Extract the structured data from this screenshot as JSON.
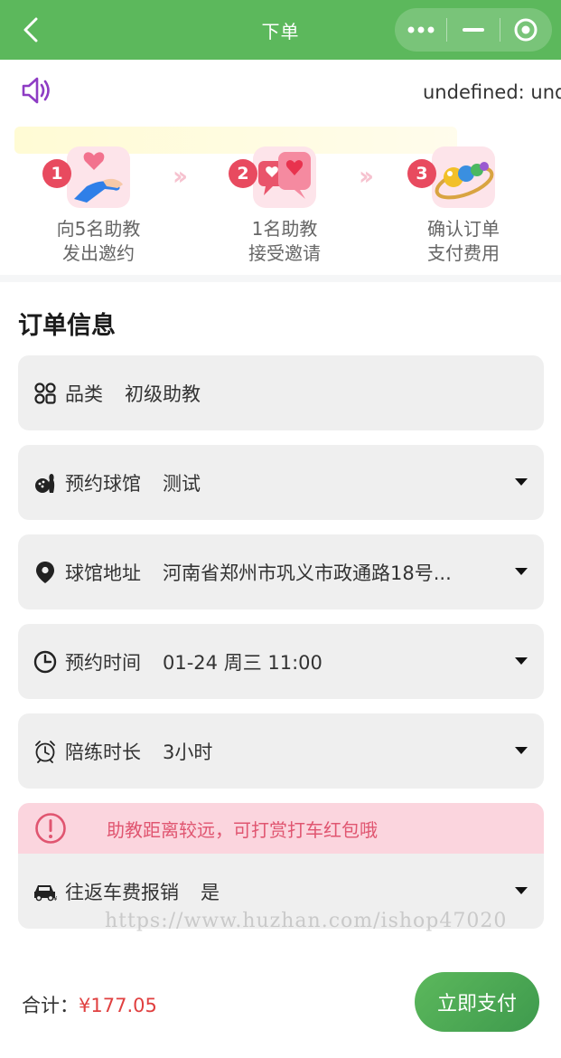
{
  "nav": {
    "title": "下单",
    "back_icon": "chevron-left-icon",
    "capsule_icons": [
      "more-dots-icon",
      "minimize-icon",
      "record-target-icon"
    ],
    "bg_color": "#5cb85c"
  },
  "notice": {
    "icon": "speaker-icon",
    "text": "undefined: undefined"
  },
  "steps": [
    {
      "num": "1",
      "line1": "向5名助教",
      "line2": "发出邀约",
      "icon": "hand-heart-icon"
    },
    {
      "num": "2",
      "line1": "1名助教",
      "line2": "接受邀请",
      "icon": "heart-bubbles-icon"
    },
    {
      "num": "3",
      "line1": "确认订单",
      "line2": "支付费用",
      "icon": "billiard-balls-icon"
    }
  ],
  "order": {
    "title": "订单信息",
    "rows": [
      {
        "label": "品类",
        "value": "初级助教",
        "icon": "grid-icon",
        "dropdown": false
      },
      {
        "label": "预约球馆",
        "value": "测试",
        "icon": "bowling-icon",
        "dropdown": true
      },
      {
        "label": "球馆地址",
        "value": "河南省郑州市巩义市政通路18号...",
        "icon": "location-pin-icon",
        "dropdown": true
      },
      {
        "label": "预约时间",
        "value": "01-24 周三 11:00",
        "icon": "clock-icon",
        "dropdown": true
      },
      {
        "label": "陪练时长",
        "value": "3小时",
        "icon": "alarm-clock-icon",
        "dropdown": true
      },
      {
        "label": "往返车费报销",
        "value": "是",
        "icon": "car-icon",
        "dropdown": true
      }
    ],
    "tip": {
      "text": "助教距离较远，可打赏打车红包哦",
      "icon": "exclamation-circle-icon",
      "color": "#e05570"
    }
  },
  "watermark": "https://www.huzhan.com/ishop47020",
  "footer": {
    "total_label": "合计：",
    "total_price": "¥177.05",
    "pay_label": "立即支付",
    "accent": "#e04040"
  }
}
